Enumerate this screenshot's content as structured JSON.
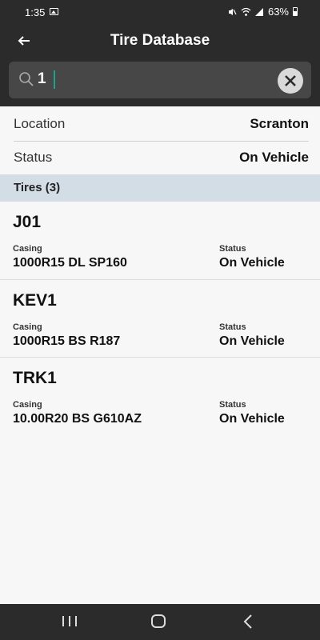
{
  "status_bar": {
    "time": "1:35",
    "battery": "63%",
    "icons": [
      "gallery-icon",
      "mute-icon",
      "wifi-icon",
      "signal-icon",
      "battery-icon"
    ]
  },
  "app_bar": {
    "title": "Tire Database",
    "back_icon": "arrow-left-icon"
  },
  "search": {
    "value": "1",
    "clear_icon": "close-icon"
  },
  "filters": [
    {
      "label": "Location",
      "value": "Scranton"
    },
    {
      "label": "Status",
      "value": "On Vehicle"
    }
  ],
  "section": {
    "title": "Tires (3)"
  },
  "tires": [
    {
      "id": "J01",
      "casing_label": "Casing",
      "casing": "1000R15 DL SP160",
      "status_label": "Status",
      "status": "On Vehicle"
    },
    {
      "id": "KEV1",
      "casing_label": "Casing",
      "casing": "1000R15 BS R187",
      "status_label": "Status",
      "status": "On Vehicle"
    },
    {
      "id": "TRK1",
      "casing_label": "Casing",
      "casing": "10.00R20 BS G610AZ",
      "status_label": "Status",
      "status": "On Vehicle"
    }
  ],
  "nav_bar": {
    "icons": [
      "recent-apps-icon",
      "home-icon",
      "back-icon"
    ]
  },
  "colors": {
    "topbar": "#2b2b2b",
    "search_bg": "#474747",
    "section_bg": "#d2dde6",
    "caret": "#1aa38f"
  }
}
